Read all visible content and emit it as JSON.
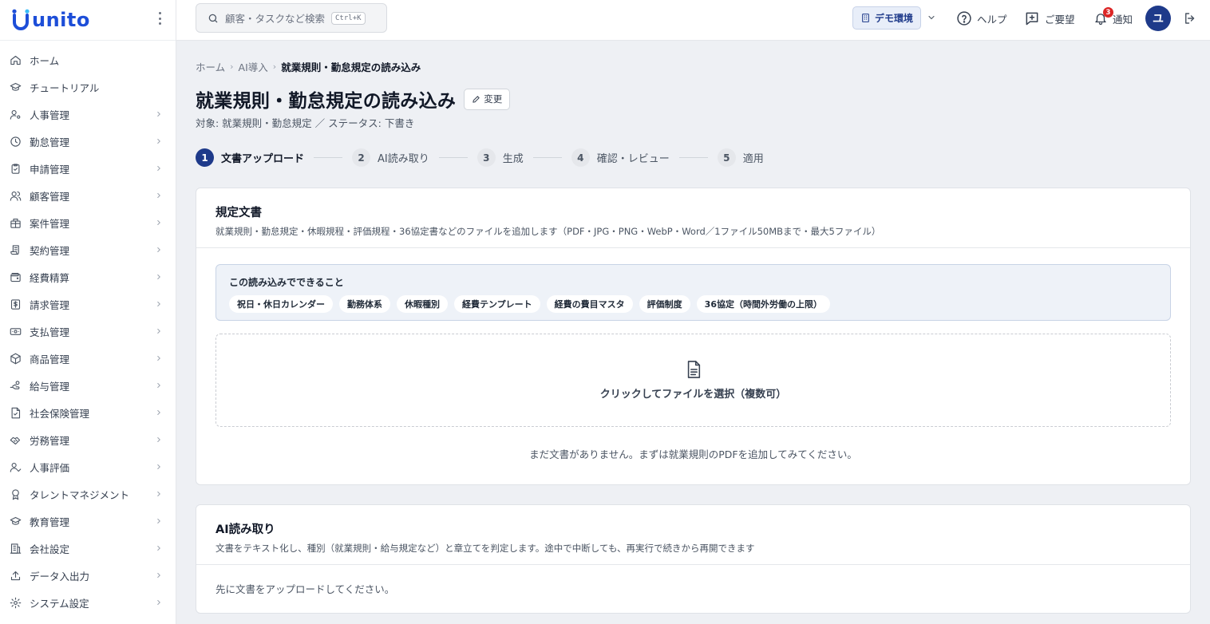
{
  "app": {
    "logo_text": "unito"
  },
  "sidebar": {
    "items": [
      {
        "label": "ホーム",
        "icon": "home-icon",
        "chevron": false
      },
      {
        "label": "チュートリアル",
        "icon": "graduation-cap-icon",
        "chevron": false
      },
      {
        "label": "人事管理",
        "icon": "user-settings-icon",
        "chevron": true
      },
      {
        "label": "勤怠管理",
        "icon": "clock-icon",
        "chevron": true
      },
      {
        "label": "申請管理",
        "icon": "clipboard-check-icon",
        "chevron": true
      },
      {
        "label": "顧客管理",
        "icon": "users-icon",
        "chevron": true
      },
      {
        "label": "案件管理",
        "icon": "building-icon",
        "chevron": true
      },
      {
        "label": "契約管理",
        "icon": "scroll-icon",
        "chevron": true
      },
      {
        "label": "経費精算",
        "icon": "wallet-icon",
        "chevron": true
      },
      {
        "label": "請求管理",
        "icon": "dollar-receipt-icon",
        "chevron": true
      },
      {
        "label": "支払管理",
        "icon": "banknote-icon",
        "chevron": true
      },
      {
        "label": "商品管理",
        "icon": "package-icon",
        "chevron": true
      },
      {
        "label": "給与管理",
        "icon": "hand-coins-icon",
        "chevron": true
      },
      {
        "label": "社会保険管理",
        "icon": "file-check-icon",
        "chevron": true
      },
      {
        "label": "労務管理",
        "icon": "handshake-icon",
        "chevron": true
      },
      {
        "label": "人事評価",
        "icon": "user-check-icon",
        "chevron": true
      },
      {
        "label": "タレントマネジメント",
        "icon": "award-icon",
        "chevron": true
      },
      {
        "label": "教育管理",
        "icon": "graduation-cap-icon",
        "chevron": true
      },
      {
        "label": "会社設定",
        "icon": "office-building-icon",
        "chevron": true
      },
      {
        "label": "データ入出力",
        "icon": "upload-icon",
        "chevron": true
      },
      {
        "label": "システム設定",
        "icon": "gear-icon",
        "chevron": true
      }
    ]
  },
  "header": {
    "search": {
      "placeholder": "顧客・タスクなど検索",
      "shortcut": "Ctrl+K"
    },
    "env_label": "デモ環境",
    "help_label": "ヘルプ",
    "request_label": "ご要望",
    "notify_label": "通知",
    "notify_count": "3",
    "avatar_initial": "ユ"
  },
  "breadcrumb": {
    "home": "ホーム",
    "parent": "AI導入",
    "current": "就業規則・勤怠規定の読み込み"
  },
  "page": {
    "title": "就業規則・勤怠規定の読み込み",
    "edit_label": "変更",
    "subtitle": "対象: 就業規則・勤怠規定 ／ ステータス: 下書き"
  },
  "steps": [
    {
      "num": "1",
      "label": "文書アップロード",
      "active": true
    },
    {
      "num": "2",
      "label": "AI読み取り",
      "active": false
    },
    {
      "num": "3",
      "label": "生成",
      "active": false
    },
    {
      "num": "4",
      "label": "確認・レビュー",
      "active": false
    },
    {
      "num": "5",
      "label": "適用",
      "active": false
    }
  ],
  "documents_card": {
    "title": "規定文書",
    "description": "就業規則・勤怠規定・休暇規程・評価規程・36協定書などのファイルを追加します（PDF・JPG・PNG・WebP・Word／1ファイル50MBまで・最大5ファイル）",
    "info_title": "この読み込みでできること",
    "chips": [
      "祝日・休日カレンダー",
      "勤務体系",
      "休暇種別",
      "経費テンプレート",
      "経費の費目マスタ",
      "評価制度",
      "36協定（時間外労働の上限）"
    ],
    "dropzone_label": "クリックしてファイルを選択（複数可）",
    "empty_note": "まだ文書がありません。まずは就業規則のPDFを追加してみてください。"
  },
  "ai_card": {
    "title": "AI読み取り",
    "description": "文書をテキスト化し、種別（就業規則・給与規定など）と章立てを判定します。途中で中断しても、再実行で続きから再開できます",
    "body": "先に文書をアップロードしてください。"
  },
  "colors": {
    "brand": "#1d4ed8",
    "accent": "#1e3a8a",
    "badge": "#dc2626"
  }
}
